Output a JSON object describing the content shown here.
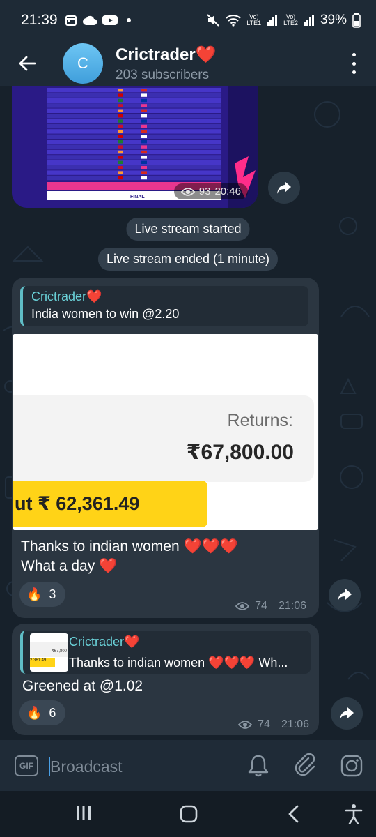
{
  "status_bar": {
    "time": "21:39",
    "lte1": "LTE1",
    "lte2": "LTE2",
    "vol": "Vo)",
    "battery": "39%"
  },
  "header": {
    "avatar_letter": "C",
    "title": "Crictrader❤️",
    "subtitle": "203 subscribers"
  },
  "image_message": {
    "views": "93",
    "time": "20:46",
    "schedule_final": "FINAL"
  },
  "service_messages": [
    "Live stream started",
    "Live stream ended (1 minute)"
  ],
  "message1": {
    "reply_name": "Crictrader❤️",
    "reply_text": "India women to win @2.20",
    "returns_label": "Returns:",
    "returns_value": "₹67,800.00",
    "cashout_text": "ut ₹ 62,361.49",
    "text_line1": "Thanks to indian women ❤️❤️❤️",
    "text_line2": "What a day ❤️",
    "reaction_emoji": "🔥",
    "reaction_count": "3",
    "views": "74",
    "time": "21:06"
  },
  "message2": {
    "reply_name": "Crictrader❤️",
    "reply_text": "Thanks to indian women ❤️❤️❤️ Wh...",
    "thumb_value": "₹67,800",
    "thumb_yellow": "2,361.49",
    "text": "Greened at @1.02",
    "reaction_emoji": "🔥",
    "reaction_count": "6",
    "views": "74",
    "time": "21:06"
  },
  "input": {
    "gif_label": "GIF",
    "placeholder": "Broadcast"
  },
  "colors": {
    "accent": "#5fbcc5",
    "bubble": "#2b3641",
    "chat_bg": "#17212b"
  }
}
